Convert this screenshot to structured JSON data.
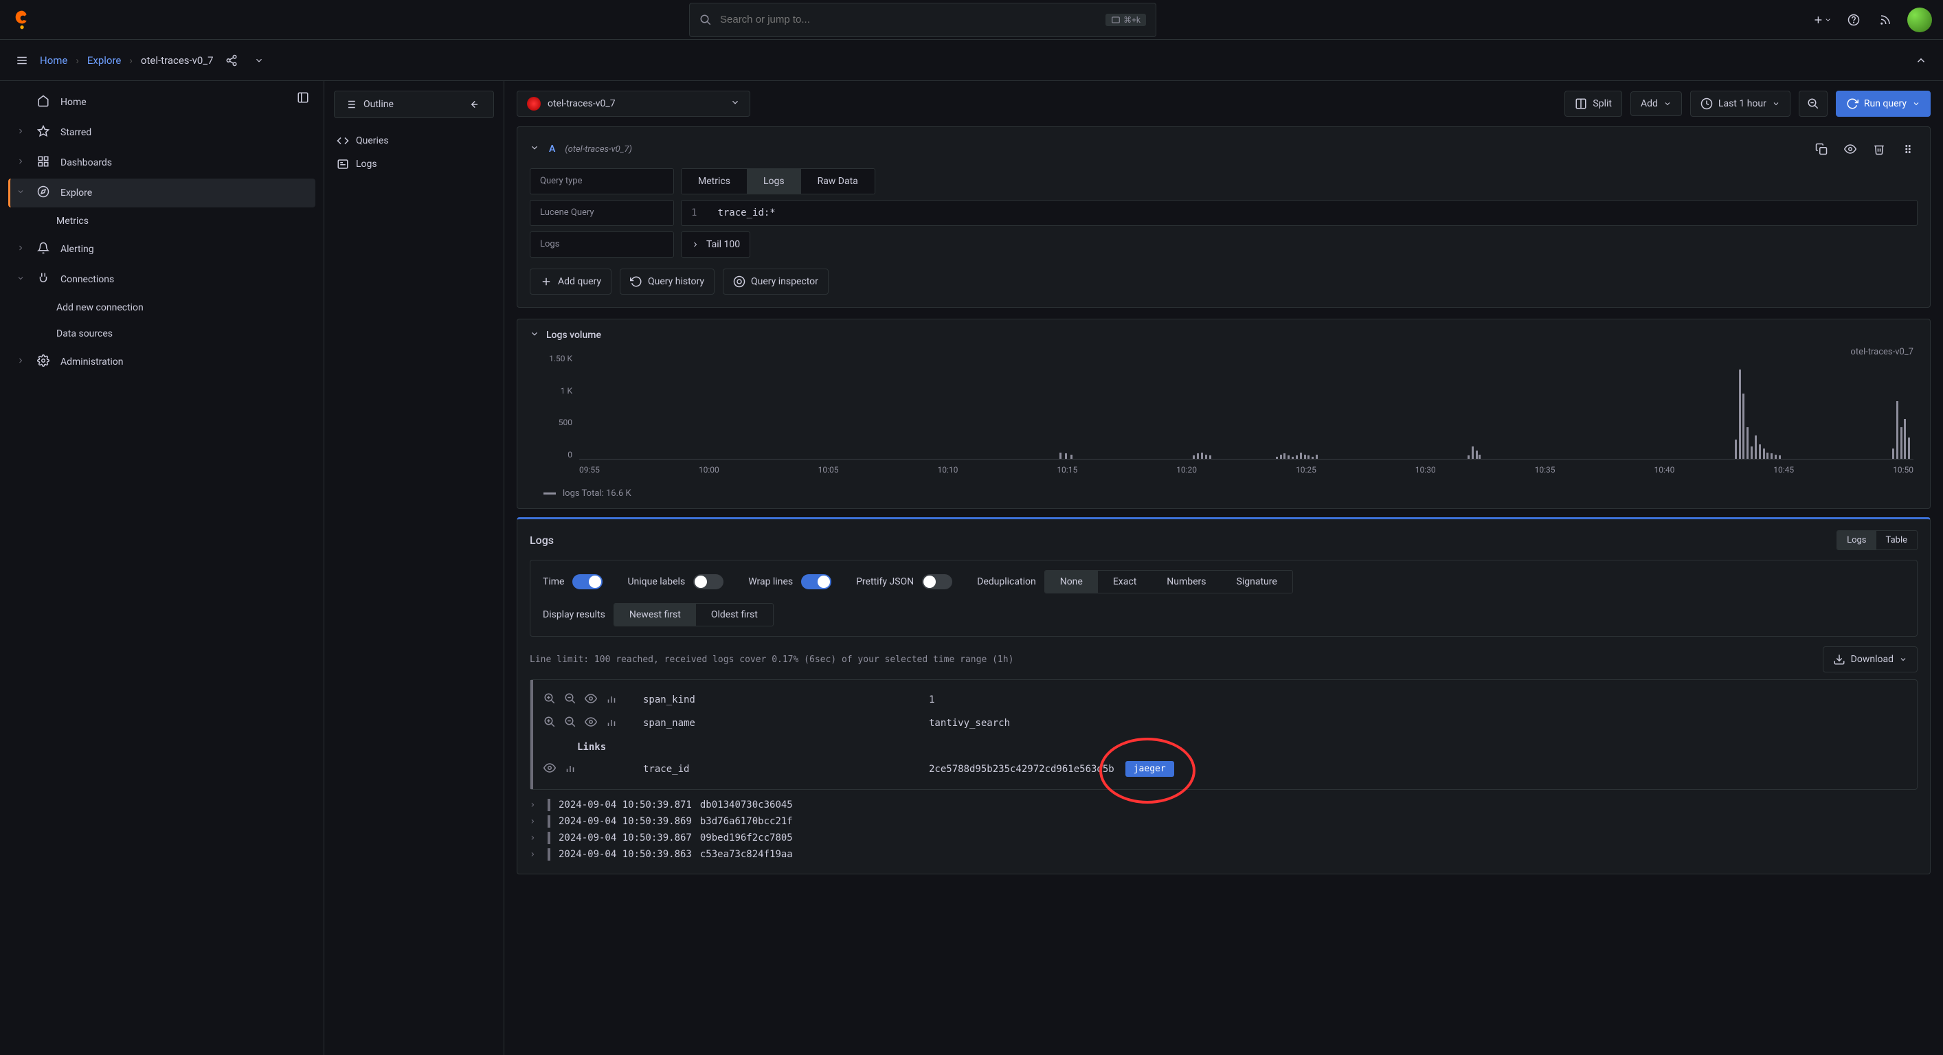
{
  "topbar": {
    "search_placeholder": "Search or jump to...",
    "kbd_hint": "⌘+k"
  },
  "breadcrumb": {
    "home": "Home",
    "explore": "Explore",
    "current": "otel-traces-v0_7"
  },
  "sidebar": {
    "items": [
      {
        "label": "Home"
      },
      {
        "label": "Starred"
      },
      {
        "label": "Dashboards"
      },
      {
        "label": "Explore"
      },
      {
        "label": "Metrics"
      },
      {
        "label": "Alerting"
      },
      {
        "label": "Connections"
      },
      {
        "label": "Add new connection"
      },
      {
        "label": "Data sources"
      },
      {
        "label": "Administration"
      }
    ]
  },
  "outline": {
    "button": "Outline",
    "queries": "Queries",
    "logs": "Logs"
  },
  "datasource": "otel-traces-v0_7",
  "toolbar": {
    "split": "Split",
    "add": "Add",
    "timerange": "Last 1 hour",
    "run": "Run query"
  },
  "query": {
    "letter": "A",
    "ds_hint": "(otel-traces-v0_7)",
    "type_label": "Query type",
    "types": {
      "metrics": "Metrics",
      "logs": "Logs",
      "raw": "Raw Data"
    },
    "lucene_label": "Lucene Query",
    "lucene_value": "trace_id:*",
    "logs_label": "Logs",
    "tail": "Tail 100",
    "add_query": "Add query",
    "history": "Query history",
    "inspector": "Query inspector"
  },
  "volume": {
    "title": "Logs volume",
    "series_name": "otel-traces-v0_7",
    "legend": "logs   Total: 16.6 K"
  },
  "chart_data": {
    "type": "bar",
    "title": "Logs volume",
    "xlabel": "",
    "ylabel": "",
    "ylim": [
      0,
      1500
    ],
    "y_ticks": [
      "1.50 K",
      "1 K",
      "500",
      "0"
    ],
    "x_ticks": [
      "09:55",
      "10:00",
      "10:05",
      "10:10",
      "10:15",
      "10:20",
      "10:25",
      "10:30",
      "10:35",
      "10:40",
      "10:45",
      "10:50"
    ],
    "series": [
      {
        "name": "logs",
        "total": "16.6 K",
        "bars": [
          {
            "x_pct": 36.0,
            "h": 6
          },
          {
            "x_pct": 36.4,
            "h": 5
          },
          {
            "x_pct": 36.8,
            "h": 4
          },
          {
            "x_pct": 46.0,
            "h": 3
          },
          {
            "x_pct": 46.3,
            "h": 5
          },
          {
            "x_pct": 46.6,
            "h": 6
          },
          {
            "x_pct": 46.9,
            "h": 4
          },
          {
            "x_pct": 47.2,
            "h": 3
          },
          {
            "x_pct": 52.2,
            "h": 2
          },
          {
            "x_pct": 52.5,
            "h": 4
          },
          {
            "x_pct": 52.8,
            "h": 5
          },
          {
            "x_pct": 53.1,
            "h": 3
          },
          {
            "x_pct": 53.4,
            "h": 2
          },
          {
            "x_pct": 53.7,
            "h": 3
          },
          {
            "x_pct": 54.0,
            "h": 6
          },
          {
            "x_pct": 54.3,
            "h": 4
          },
          {
            "x_pct": 54.6,
            "h": 3
          },
          {
            "x_pct": 54.9,
            "h": 2
          },
          {
            "x_pct": 55.2,
            "h": 4
          },
          {
            "x_pct": 66.6,
            "h": 3
          },
          {
            "x_pct": 66.9,
            "h": 12
          },
          {
            "x_pct": 67.2,
            "h": 8
          },
          {
            "x_pct": 67.4,
            "h": 4
          },
          {
            "x_pct": 86.6,
            "h": 18
          },
          {
            "x_pct": 86.9,
            "h": 85
          },
          {
            "x_pct": 87.2,
            "h": 62
          },
          {
            "x_pct": 87.5,
            "h": 30
          },
          {
            "x_pct": 87.8,
            "h": 12
          },
          {
            "x_pct": 88.1,
            "h": 22
          },
          {
            "x_pct": 88.4,
            "h": 14
          },
          {
            "x_pct": 88.7,
            "h": 10
          },
          {
            "x_pct": 89.0,
            "h": 6
          },
          {
            "x_pct": 89.3,
            "h": 5
          },
          {
            "x_pct": 89.6,
            "h": 4
          },
          {
            "x_pct": 89.9,
            "h": 3
          },
          {
            "x_pct": 98.4,
            "h": 10
          },
          {
            "x_pct": 98.7,
            "h": 55
          },
          {
            "x_pct": 99.0,
            "h": 30
          },
          {
            "x_pct": 99.3,
            "h": 38
          },
          {
            "x_pct": 99.6,
            "h": 20
          }
        ]
      }
    ]
  },
  "logs": {
    "title": "Logs",
    "view_logs": "Logs",
    "view_table": "Table",
    "opt_time": "Time",
    "opt_unique": "Unique labels",
    "opt_wrap": "Wrap lines",
    "opt_pretty": "Prettify JSON",
    "opt_dedup": "Deduplication",
    "dedup": {
      "none": "None",
      "exact": "Exact",
      "numbers": "Numbers",
      "signature": "Signature"
    },
    "display_label": "Display results",
    "newest": "Newest first",
    "oldest": "Oldest first",
    "limit_text": "Line limit: 100 reached, received logs cover 0.17% (6sec) of your selected time range (1h)",
    "download": "Download",
    "detail": {
      "span_kind_k": "span_kind",
      "span_kind_v": "1",
      "span_name_k": "span_name",
      "span_name_v": "tantivy_search",
      "links": "Links",
      "trace_id_k": "trace_id",
      "trace_id_v": "2ce5788d95b235c42972cd961e563d5b",
      "jaeger": "jaeger"
    },
    "lines": [
      {
        "ts": "2024-09-04 10:50:39.871",
        "msg": "db01340730c36045"
      },
      {
        "ts": "2024-09-04 10:50:39.869",
        "msg": "b3d76a6170bcc21f"
      },
      {
        "ts": "2024-09-04 10:50:39.867",
        "msg": "09bed196f2cc7805"
      },
      {
        "ts": "2024-09-04 10:50:39.863",
        "msg": "c53ea73c824f19aa"
      }
    ]
  }
}
